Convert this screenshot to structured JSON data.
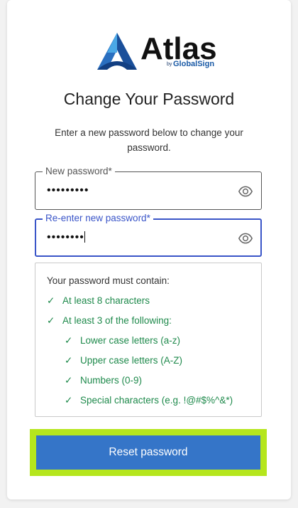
{
  "logo": {
    "word": "Atlas",
    "by": "by",
    "company": "GlobalSign"
  },
  "title": "Change Your Password",
  "subtitle": "Enter a new password below to change your password.",
  "new_password": {
    "label": "New password*",
    "value": "•••••••••"
  },
  "confirm_password": {
    "label": "Re-enter new password*",
    "value": "••••••••"
  },
  "requirements": {
    "heading": "Your password must contain:",
    "items": [
      {
        "check": "✓",
        "text": "At least 8 characters"
      },
      {
        "check": "✓",
        "text": "At least 3 of the following:"
      },
      {
        "check": "✓",
        "text": "Lower case letters (a-z)"
      },
      {
        "check": "✓",
        "text": "Upper case letters (A-Z)"
      },
      {
        "check": "✓",
        "text": "Numbers (0-9)"
      },
      {
        "check": "✓",
        "text": "Special characters (e.g. !@#$%^&*)"
      }
    ]
  },
  "reset_button": "Reset password",
  "colors": {
    "accent": "#3a55c8",
    "button": "#3575c8",
    "success": "#1f8a4c",
    "highlight": "#b5e61d"
  }
}
